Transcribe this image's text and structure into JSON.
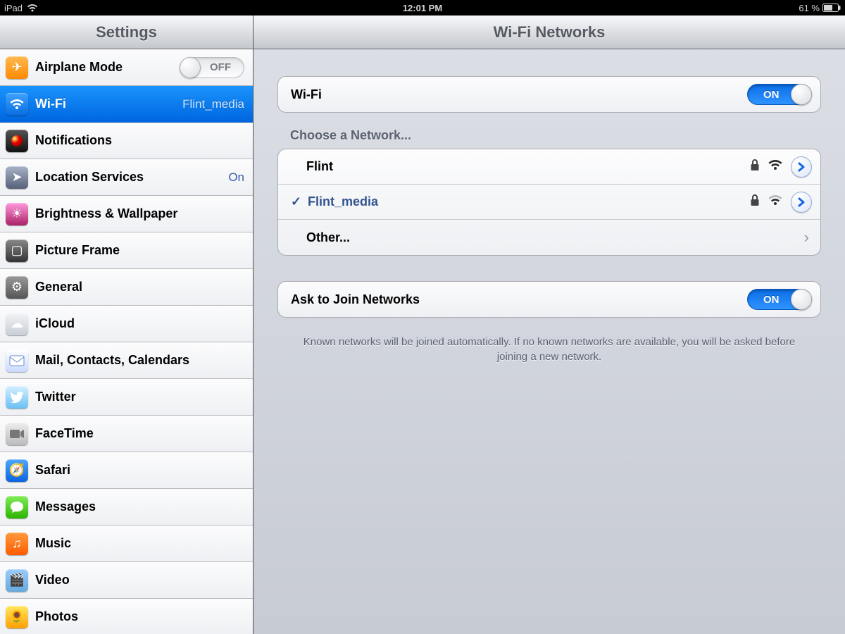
{
  "status_bar": {
    "device": "iPad",
    "time": "12:01 PM",
    "battery": "61 %"
  },
  "header": {
    "left_title": "Settings",
    "right_title": "Wi-Fi Networks"
  },
  "sidebar": {
    "items": [
      {
        "id": "airplane",
        "label": "Airplane Mode",
        "value": "",
        "toggle": "OFF"
      },
      {
        "id": "wifi",
        "label": "Wi-Fi",
        "value": "Flint_media",
        "selected": true
      },
      {
        "id": "notif",
        "label": "Notifications",
        "value": ""
      },
      {
        "id": "loc",
        "label": "Location Services",
        "value": "On"
      },
      {
        "id": "bright",
        "label": "Brightness & Wallpaper",
        "value": ""
      },
      {
        "id": "picframe",
        "label": "Picture Frame",
        "value": ""
      },
      {
        "id": "general",
        "label": "General",
        "value": ""
      },
      {
        "id": "icloud",
        "label": "iCloud",
        "value": ""
      },
      {
        "id": "mail",
        "label": "Mail, Contacts, Calendars",
        "value": ""
      },
      {
        "id": "twitter",
        "label": "Twitter",
        "value": ""
      },
      {
        "id": "facetime",
        "label": "FaceTime",
        "value": ""
      },
      {
        "id": "safari",
        "label": "Safari",
        "value": ""
      },
      {
        "id": "messages",
        "label": "Messages",
        "value": ""
      },
      {
        "id": "music",
        "label": "Music",
        "value": ""
      },
      {
        "id": "video",
        "label": "Video",
        "value": ""
      },
      {
        "id": "photos",
        "label": "Photos",
        "value": ""
      }
    ]
  },
  "content": {
    "wifi_row_label": "Wi-Fi",
    "wifi_on": "ON",
    "choose_header": "Choose a Network...",
    "networks": [
      {
        "name": "Flint",
        "locked": true,
        "connected": false
      },
      {
        "name": "Flint_media",
        "locked": true,
        "connected": true
      }
    ],
    "other_label": "Other...",
    "ask_label": "Ask to Join Networks",
    "ask_on": "ON",
    "footer": "Known networks will be joined automatically. If no known networks are available, you will be asked before joining a new network."
  }
}
